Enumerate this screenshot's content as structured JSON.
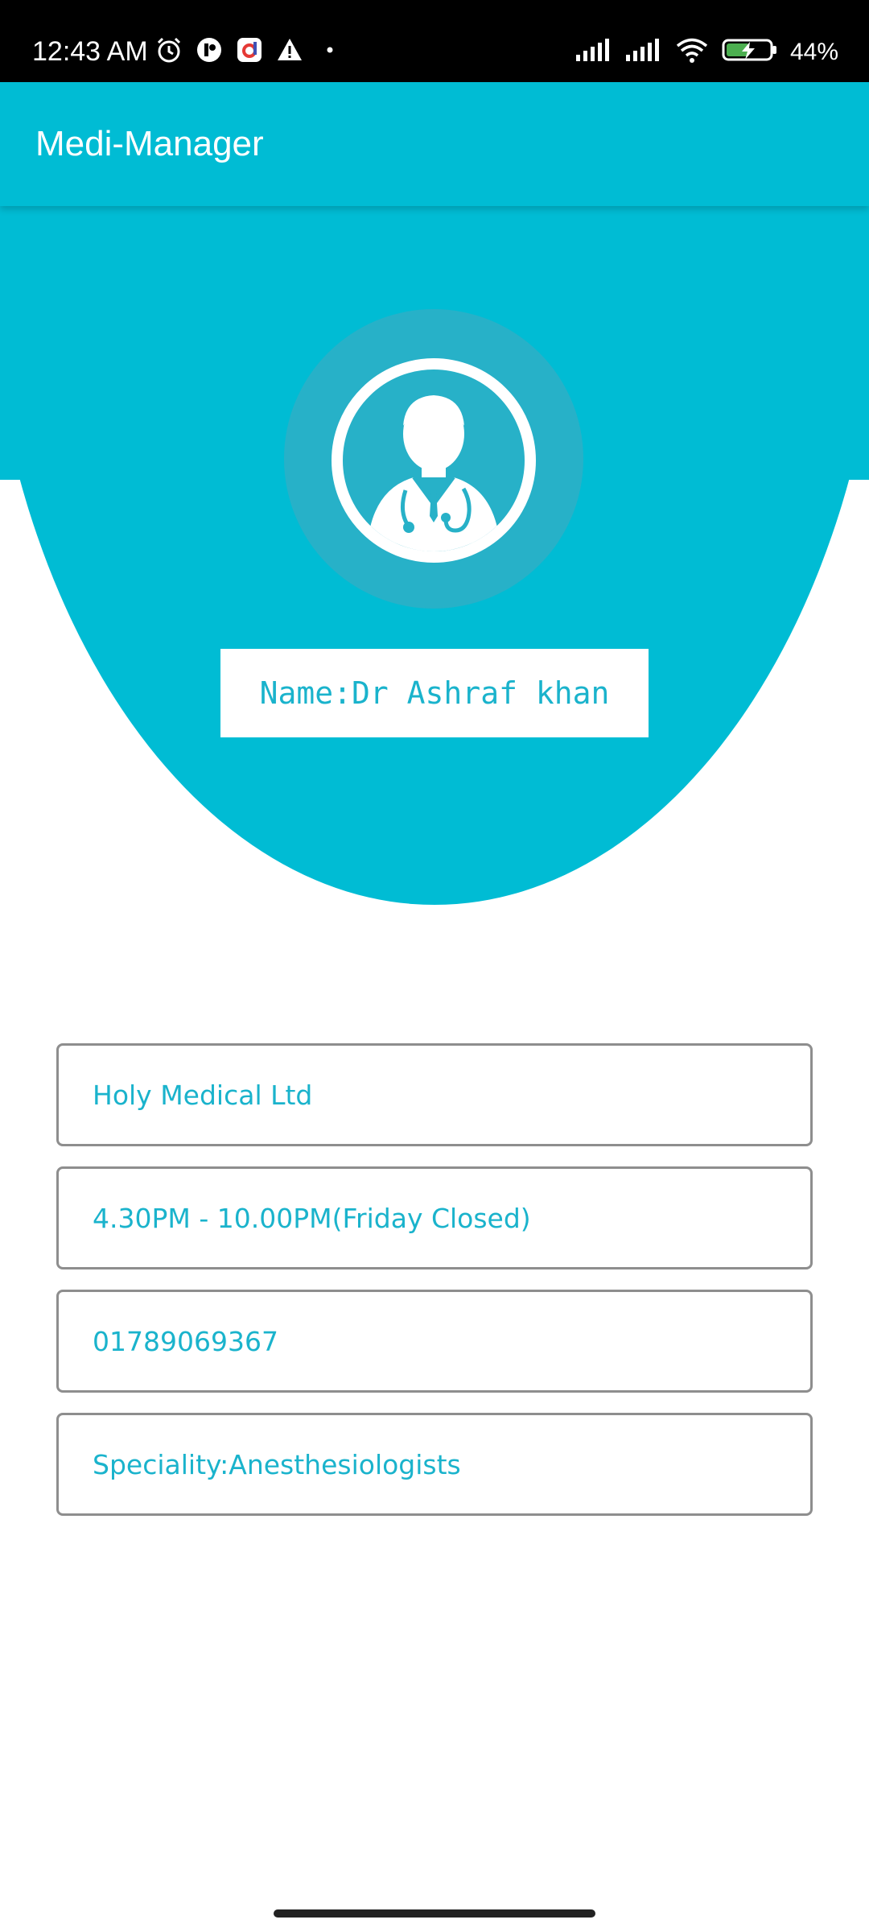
{
  "status_bar": {
    "time": "12:43 AM",
    "battery_percent": "44%",
    "left_icons": [
      "alarm-icon",
      "app-notification-icon",
      "app-notification-icon",
      "warning-icon",
      "dot-icon"
    ],
    "right_icons": [
      "signal-icon",
      "signal-icon",
      "wifi-icon",
      "battery-charging-icon"
    ]
  },
  "app_bar": {
    "title": "Medi-Manager"
  },
  "profile": {
    "avatar_icon": "doctor-icon",
    "name": "Name:Dr Ashraf khan"
  },
  "details": {
    "hospital": "Holy Medical Ltd",
    "hours": "4.30PM - 10.00PM(Friday Closed)",
    "phone": "01789069367",
    "speciality": "Speciality:Anesthesiologists"
  },
  "colors": {
    "primary": "#00bcd4",
    "avatar_halo": "#27b1c8",
    "text_accent": "#1ab3cc",
    "field_border": "#8e8e8e"
  }
}
